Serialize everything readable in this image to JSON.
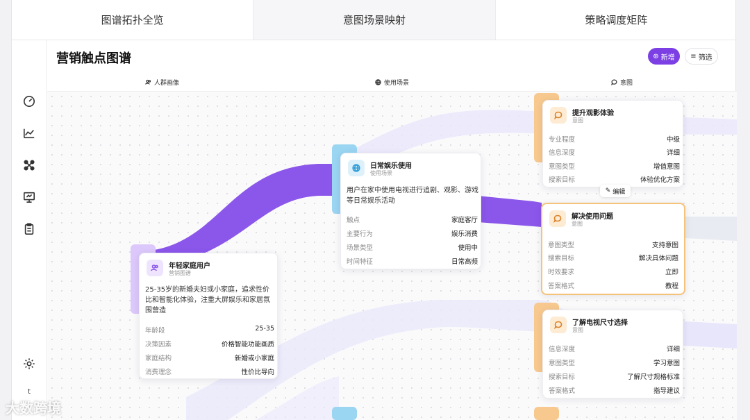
{
  "tabs": [
    {
      "label": "图谱拓扑全览"
    },
    {
      "label": "意图场景映射"
    },
    {
      "label": "策略调度矩阵"
    }
  ],
  "header": {
    "title": "营销触点图谱",
    "add_label": "新增",
    "filter_label": "筛选"
  },
  "columns": [
    {
      "label": "人群画像",
      "icon": "users-icon"
    },
    {
      "label": "使用场景",
      "icon": "globe-icon"
    },
    {
      "label": "意图",
      "icon": "chat-bubble-icon"
    }
  ],
  "rail": {
    "items": [
      "dashboard-icon",
      "chart-icon",
      "graph-nodes-icon",
      "presentation-icon",
      "clipboard-icon"
    ],
    "settings_icon": "gear-icon",
    "avatar": "t"
  },
  "cards": {
    "persona": {
      "title": "年轻家庭用户",
      "subtitle": "营销图谱",
      "description": "25-35岁的新婚夫妇或小家庭，追求性价比和智能化体验，注重大屏娱乐和家居氛围营造",
      "rows": [
        {
          "k": "年龄段",
          "v": "25-35"
        },
        {
          "k": "决策因素",
          "v": "价格智能功能画质"
        },
        {
          "k": "家庭结构",
          "v": "新婚或小家庭"
        },
        {
          "k": "消费理念",
          "v": "性价比导向"
        }
      ]
    },
    "scenario": {
      "title": "日常娱乐使用",
      "subtitle": "使用场景",
      "description": "用户在家中使用电视进行追剧、观影、游戏等日常娱乐活动",
      "rows": [
        {
          "k": "触点",
          "v": "家庭客厅"
        },
        {
          "k": "主要行为",
          "v": "娱乐消费"
        },
        {
          "k": "场景类型",
          "v": "使用中"
        },
        {
          "k": "时间特征",
          "v": "日常高频"
        }
      ]
    },
    "intent1": {
      "title": "提升观影体验",
      "subtitle": "意图",
      "rows": [
        {
          "k": "专业程度",
          "v": "中级"
        },
        {
          "k": "信息深度",
          "v": "详细"
        },
        {
          "k": "意图类型",
          "v": "增值意图"
        },
        {
          "k": "搜索目标",
          "v": "体验优化方案"
        }
      ]
    },
    "intent2": {
      "title": "解决使用问题",
      "subtitle": "意图",
      "rows": [
        {
          "k": "意图类型",
          "v": "支持意图"
        },
        {
          "k": "搜索目标",
          "v": "解决具体问题"
        },
        {
          "k": "时效要求",
          "v": "立即"
        },
        {
          "k": "答案格式",
          "v": "教程"
        }
      ]
    },
    "intent3": {
      "title": "了解电视尺寸选择",
      "subtitle": "意图",
      "rows": [
        {
          "k": "信息深度",
          "v": "详细"
        },
        {
          "k": "意图类型",
          "v": "学习意图"
        },
        {
          "k": "搜索目标",
          "v": "了解尺寸规格标准"
        },
        {
          "k": "答案格式",
          "v": "指导建议"
        }
      ]
    }
  },
  "edit_label": "编辑",
  "watermark": "大数跨境",
  "colors": {
    "accent": "#7b3fe4",
    "persona": "#c9a8f5",
    "scenario": "#7cc8ef",
    "intent": "#f5b25c"
  }
}
